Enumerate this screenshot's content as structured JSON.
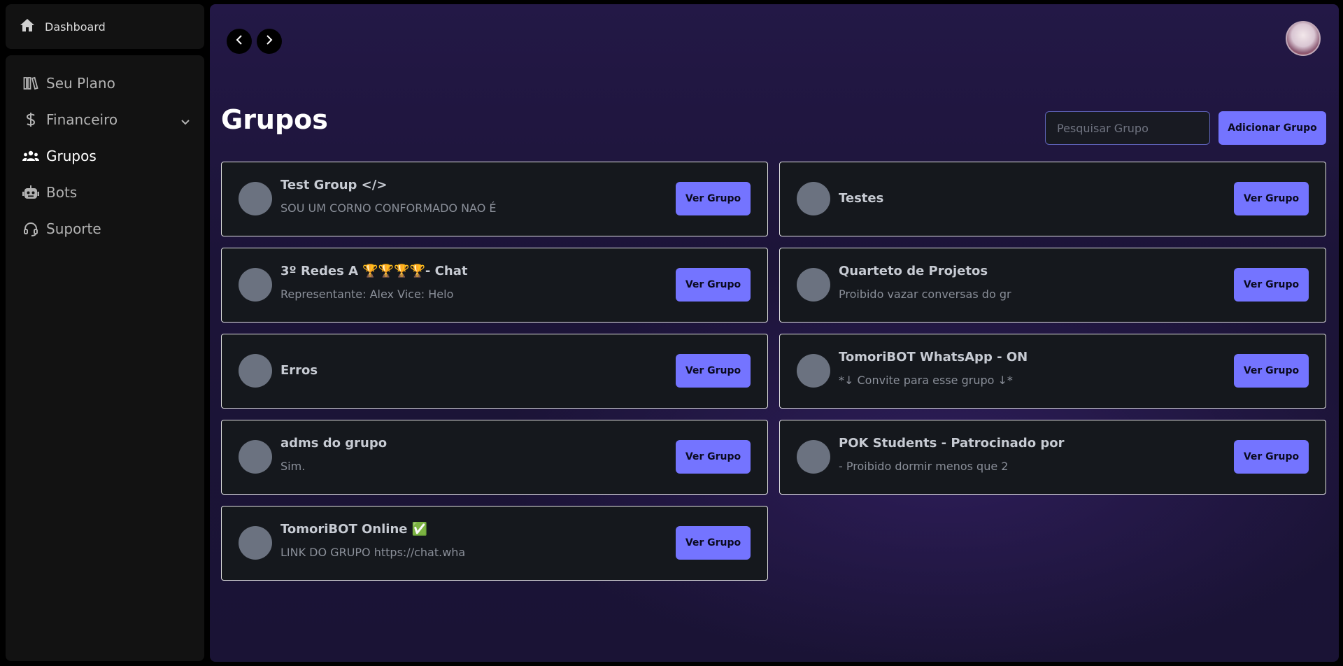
{
  "sidebar": {
    "dashboard_label": "Dashboard",
    "items": [
      {
        "label": "Seu Plano",
        "icon": "library-icon"
      },
      {
        "label": "Financeiro",
        "icon": "dollar-icon"
      },
      {
        "label": "Grupos",
        "icon": "users-icon"
      },
      {
        "label": "Bots",
        "icon": "robot-icon"
      },
      {
        "label": "Suporte",
        "icon": "headset-icon"
      }
    ]
  },
  "main": {
    "title": "Grupos",
    "search_placeholder": "Pesquisar Grupo",
    "add_button_label": "Adicionar Grupo",
    "view_button_label": "Ver Grupo",
    "groups": [
      {
        "name": "Test Group </>",
        "description": "SOU UM CORNO CONFORMADO NAO É"
      },
      {
        "name": "Testes",
        "description": ""
      },
      {
        "name": "3º Redes A 🏆🏆🏆🏆- Chat",
        "description": "Representante: Alex Vice: Helo"
      },
      {
        "name": "Quarteto de Projetos",
        "description": "Proibido vazar conversas do gr"
      },
      {
        "name": "Erros",
        "description": ""
      },
      {
        "name": "TomoriBOT WhatsApp - ON",
        "description": "*↓ Convite para esse grupo ↓*"
      },
      {
        "name": "adms do grupo",
        "description": "Sim."
      },
      {
        "name": "POK Students - Patrocinado por",
        "description": "- Proibido dormir menos que 2"
      },
      {
        "name": "TomoriBOT Online ✅",
        "description": "LINK DO GRUPO https://chat.wha"
      }
    ]
  },
  "colors": {
    "accent": "#7474ff",
    "sidebar_bg": "#121212",
    "card_bg": "#15181d"
  }
}
